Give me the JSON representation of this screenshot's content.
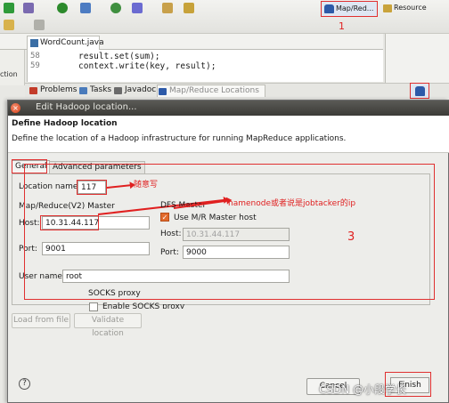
{
  "toolbar": {
    "perspective_mapred": "Map/Red...",
    "perspective_resource": "Resource",
    "annotation_1": "1"
  },
  "editor": {
    "tab_label": "WordCount.java",
    "lines": [
      {
        "num": "58",
        "code": "result.set(sum);"
      },
      {
        "num": "59",
        "code": "context.write(key, result);"
      }
    ],
    "left_trunc": "ction"
  },
  "views": {
    "tabs": [
      {
        "label": "Problems",
        "color": "#c33c2a"
      },
      {
        "label": "Tasks",
        "color": "#4a7bbb"
      },
      {
        "label": "Javadoc",
        "color": "#6a6a6a"
      },
      {
        "label": "Map/Reduce Locations",
        "color": "#2d5aa8"
      }
    ]
  },
  "dialog": {
    "title": "Edit Hadoop location...",
    "header_title": "Define Hadoop location",
    "header_desc": "Define the location of a Hadoop infrastructure for running MapReduce applications.",
    "tabs": [
      "General",
      "Advanced parameters"
    ],
    "location_name_label": "Location name:",
    "location_name_value": "117",
    "mr_group_label": "Map/Reduce(V2) Master",
    "mr_host_label": "Host:",
    "mr_host_value": "10.31.44.117",
    "mr_port_label": "Port:",
    "mr_port_value": "9001",
    "dfs_group_label": "DFS Master",
    "dfs_use_mr_label": "Use M/R Master host",
    "dfs_host_label": "Host:",
    "dfs_host_value": "10.31.44.117",
    "dfs_port_label": "Port:",
    "dfs_port_value": "9000",
    "user_name_label": "User name:",
    "user_name_value": "root",
    "socks_group_label": "SOCKS proxy",
    "socks_enable_label": "Enable SOCKS proxy",
    "btn_load": "Load from file",
    "btn_validate": "Validate location",
    "btn_cancel": "Cancel",
    "btn_finish": "Finish",
    "annotation_3": "3",
    "annotation_any": "随意写",
    "annotation_namenode": "namenode或者说是jobtacker的ip"
  },
  "watermark": "CSDN @小段学长",
  "colors": {
    "annotation_red": "#e02020",
    "titlebar": "#3c3b37",
    "checkbox_orange": "#e26a2c",
    "hadoop_blue": "#2d5aa8"
  }
}
